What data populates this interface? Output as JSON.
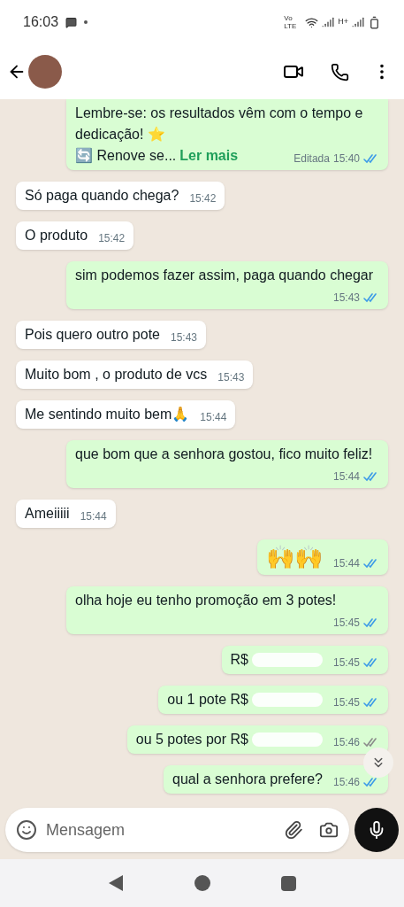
{
  "status_bar": {
    "time": "16:03",
    "network": "Vo LTE",
    "data": "H+"
  },
  "messages": [
    {
      "kind": "outgoing",
      "lines": [
        "Lembre-se: os resultados vêm com o tempo e dedicação! ⭐"
      ],
      "preview": "🔄 Renove se...",
      "more": "Ler mais",
      "edited": "Editada",
      "time": "15:40",
      "read": true
    },
    {
      "kind": "incoming",
      "text": "Só paga quando chega?",
      "time": "15:42"
    },
    {
      "kind": "incoming",
      "text": "O produto",
      "time": "15:42"
    },
    {
      "kind": "outgoing",
      "text": "sim podemos fazer assim, paga quando chegar",
      "time": "15:43",
      "read": true
    },
    {
      "kind": "incoming",
      "text": "Pois quero outro pote",
      "time": "15:43"
    },
    {
      "kind": "incoming",
      "text": "Muito bom , o produto de vcs",
      "time": "15:43"
    },
    {
      "kind": "incoming",
      "text": "Me sentindo muito bem🙏",
      "time": "15:44"
    },
    {
      "kind": "outgoing",
      "text": "que bom que a senhora gostou, fico muito feliz!",
      "time": "15:44",
      "read": true
    },
    {
      "kind": "incoming",
      "text": "Ameiiiii",
      "time": "15:44"
    },
    {
      "kind": "emoji",
      "text": "🙌🙌",
      "time": "15:44",
      "read": true
    },
    {
      "kind": "outgoing",
      "text": "olha hoje eu tenho promoção em 3 potes!",
      "time": "15:45",
      "read": true
    },
    {
      "kind": "outgoing",
      "text": "R$",
      "time": "15:45",
      "read": true,
      "redacted": true
    },
    {
      "kind": "outgoing",
      "text": "ou 1 pote R$",
      "time": "15:45",
      "read": true,
      "redacted": true
    },
    {
      "kind": "outgoing",
      "text": "ou 5 potes por R$",
      "time": "15:46",
      "read": false,
      "redacted": true
    },
    {
      "kind": "outgoing",
      "text": "qual a senhora prefere?",
      "time": "15:46",
      "read": true
    }
  ],
  "composer": {
    "placeholder": "Mensagem"
  }
}
